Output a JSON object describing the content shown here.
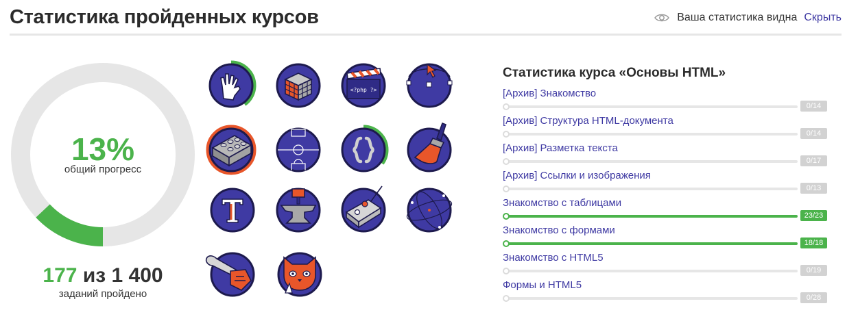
{
  "header": {
    "title": "Статистика пройденных курсов",
    "visibility_text": "Ваша статистика видна",
    "hide_label": "Скрыть"
  },
  "progress": {
    "percent_text": "13%",
    "percent_value": 0.13,
    "percent_label": "общий прогресс",
    "tasks_done": "177",
    "tasks_sep": "из",
    "tasks_total": "1 400",
    "tasks_label": "заданий пройдено",
    "colors": {
      "fill": "#4bb34b",
      "track": "#e6e6e6"
    }
  },
  "badges": [
    {
      "name": "vulcan-hand-icon",
      "progress": 0.4,
      "ring_color": "#4bb34b"
    },
    {
      "name": "rubiks-cube-icon",
      "progress": 0
    },
    {
      "name": "php-clapper-icon",
      "progress": 0,
      "text": "<?php ?>"
    },
    {
      "name": "vector-path-icon",
      "progress": 0
    },
    {
      "name": "lego-brick-icon",
      "progress": 1,
      "ring_color": "#e8562a"
    },
    {
      "name": "football-field-icon",
      "progress": 0
    },
    {
      "name": "curly-braces-icon",
      "progress": 0.35,
      "ring_color": "#4bb34b"
    },
    {
      "name": "paint-brush-icon",
      "progress": 0
    },
    {
      "name": "typography-t-icon",
      "progress": 0
    },
    {
      "name": "anvil-icon",
      "progress": 0
    },
    {
      "name": "remote-control-icon",
      "progress": 0
    },
    {
      "name": "atom-orbit-icon",
      "progress": 0
    },
    {
      "name": "chainsaw-icon",
      "progress": 0
    },
    {
      "name": "cat-face-icon",
      "progress": 0
    }
  ],
  "course": {
    "title": "Статистика курса «Основы HTML»",
    "sections": [
      {
        "name": "[Архив] Знакомство",
        "done": 0,
        "total": 14,
        "count": "0/14"
      },
      {
        "name": "[Архив] Структура HTML-документа",
        "done": 0,
        "total": 14,
        "count": "0/14"
      },
      {
        "name": "[Архив] Разметка текста",
        "done": 0,
        "total": 17,
        "count": "0/17"
      },
      {
        "name": "[Архив] Ссылки и изображения",
        "done": 0,
        "total": 13,
        "count": "0/13"
      },
      {
        "name": "Знакомство с таблицами",
        "done": 23,
        "total": 23,
        "count": "23/23"
      },
      {
        "name": "Знакомство с формами",
        "done": 18,
        "total": 18,
        "count": "18/18"
      },
      {
        "name": "Знакомство с HTML5",
        "done": 0,
        "total": 19,
        "count": "0/19"
      },
      {
        "name": "Формы и HTML5",
        "done": 0,
        "total": 28,
        "count": "0/28"
      }
    ]
  }
}
